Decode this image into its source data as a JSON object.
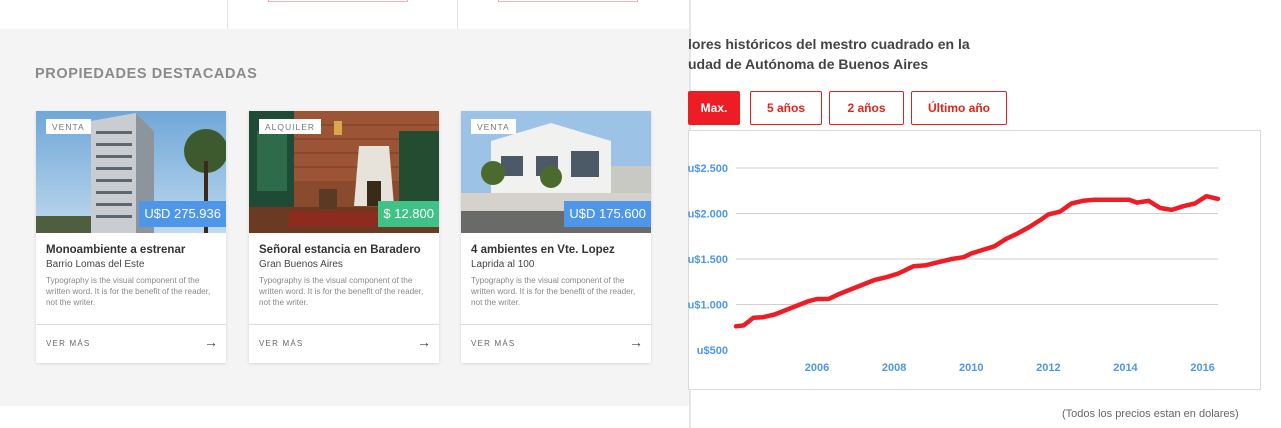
{
  "featured": {
    "title": "PROPIEDADES DESTACADAS",
    "cards": [
      {
        "tag": "VENTA",
        "price": "U$D 275.936",
        "price_color": "#4d96e8",
        "title": "Monoambiente a estrenar",
        "location": "Barrio Lomas del Este",
        "description": "Typography is the visual component of the written word. It is for the benefit of the reader, not the writer.",
        "more_label": "VER MÁS",
        "arrow_icon": "arrow-right-icon"
      },
      {
        "tag": "ALQUILER",
        "price": "$ 12.800",
        "price_color": "#3fc288",
        "title": "Señoral estancia en Baradero",
        "location": "Gran Buenos Aires",
        "description": "Typography is the visual component of the written word. It is for the benefit of the reader, not the writer.",
        "more_label": "VER MÁS",
        "arrow_icon": "arrow-right-icon"
      },
      {
        "tag": "VENTA",
        "price": "U$D 175.600",
        "price_color": "#4d96e8",
        "title": "4 ambientes en Vte. Lopez",
        "location": "Laprida al 100",
        "description": "Typography is the visual component of the written word. It is for the benefit of the reader, not the writer.",
        "more_label": "VER MÁS",
        "arrow_icon": "arrow-right-icon"
      }
    ]
  },
  "price_history": {
    "title_line1": "lores históricos del mestro cuadrado en la",
    "title_line2": "udad de Autónoma de Buenos Aires",
    "range_buttons": [
      {
        "label": "Max.",
        "active": true
      },
      {
        "label": "5 años",
        "active": false
      },
      {
        "label": "2 años",
        "active": false
      },
      {
        "label": "Último año",
        "active": false
      }
    ],
    "footnote": "(Todos los precios estan en dolares)",
    "accent_color": "#ee1c25"
  },
  "chart_data": {
    "type": "line",
    "title": "",
    "xlabel": "",
    "ylabel": "",
    "x_ticks": [
      "2006",
      "2008",
      "2010",
      "2012",
      "2014",
      "2016"
    ],
    "y_ticks": [
      "u$500",
      "u$1.000",
      "u$1.500",
      "u$2.000",
      "u$2.500"
    ],
    "ylim": [
      500,
      2600
    ],
    "xlim": [
      2003.9,
      2016.4
    ],
    "grid": true,
    "series": [
      {
        "color": "#ee1c25",
        "x": [
          2003.9,
          2004.1,
          2004.35,
          2004.6,
          2004.9,
          2005.2,
          2005.5,
          2005.8,
          2006.0,
          2006.3,
          2006.6,
          2006.9,
          2007.2,
          2007.5,
          2007.8,
          2008.1,
          2008.5,
          2008.8,
          2009.2,
          2009.5,
          2009.8,
          2010.0,
          2010.3,
          2010.6,
          2010.9,
          2011.2,
          2011.5,
          2011.8,
          2012.0,
          2012.3,
          2012.6,
          2012.9,
          2013.2,
          2013.5,
          2013.8,
          2014.1,
          2014.3,
          2014.6,
          2014.9,
          2015.2,
          2015.5,
          2015.8,
          2016.1,
          2016.4
        ],
        "y": [
          760,
          770,
          855,
          860,
          890,
          940,
          990,
          1040,
          1060,
          1060,
          1120,
          1170,
          1220,
          1270,
          1300,
          1340,
          1420,
          1430,
          1470,
          1500,
          1520,
          1560,
          1600,
          1640,
          1720,
          1780,
          1850,
          1930,
          1990,
          2020,
          2110,
          2140,
          2150,
          2150,
          2150,
          2150,
          2120,
          2140,
          2060,
          2040,
          2080,
          2110,
          2190,
          2160
        ]
      }
    ]
  }
}
